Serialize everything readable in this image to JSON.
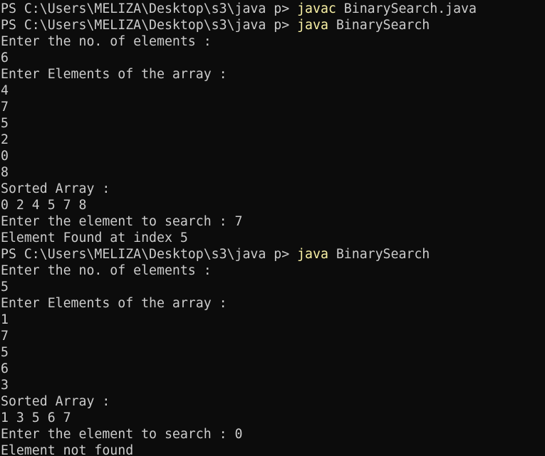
{
  "colors": {
    "background": "#0c0c0c",
    "foreground": "#cccccc",
    "command": "#f9f1a5"
  },
  "terminal": {
    "lines": [
      {
        "prompt": "PS C:\\Users\\MELIZA\\Desktop\\s3\\java p> ",
        "command": "javac",
        "args": " BinarySearch.java"
      },
      {
        "prompt": "PS C:\\Users\\MELIZA\\Desktop\\s3\\java p> ",
        "command": "java",
        "args": " BinarySearch"
      },
      {
        "text": "Enter the no. of elements :"
      },
      {
        "text": "6"
      },
      {
        "text": "Enter Elements of the array :"
      },
      {
        "text": "4"
      },
      {
        "text": "7"
      },
      {
        "text": "5"
      },
      {
        "text": "2"
      },
      {
        "text": "0"
      },
      {
        "text": "8"
      },
      {
        "text": "Sorted Array :"
      },
      {
        "text": "0 2 4 5 7 8"
      },
      {
        "text": "Enter the element to search : 7"
      },
      {
        "text": "Element Found at index 5"
      },
      {
        "prompt": "PS C:\\Users\\MELIZA\\Desktop\\s3\\java p> ",
        "command": "java",
        "args": " BinarySearch"
      },
      {
        "text": "Enter the no. of elements :"
      },
      {
        "text": "5"
      },
      {
        "text": "Enter Elements of the array :"
      },
      {
        "text": "1"
      },
      {
        "text": "7"
      },
      {
        "text": "5"
      },
      {
        "text": "6"
      },
      {
        "text": "3"
      },
      {
        "text": "Sorted Array :"
      },
      {
        "text": "1 3 5 6 7"
      },
      {
        "text": "Enter the element to search : 0"
      },
      {
        "text": "Element not found"
      }
    ]
  }
}
